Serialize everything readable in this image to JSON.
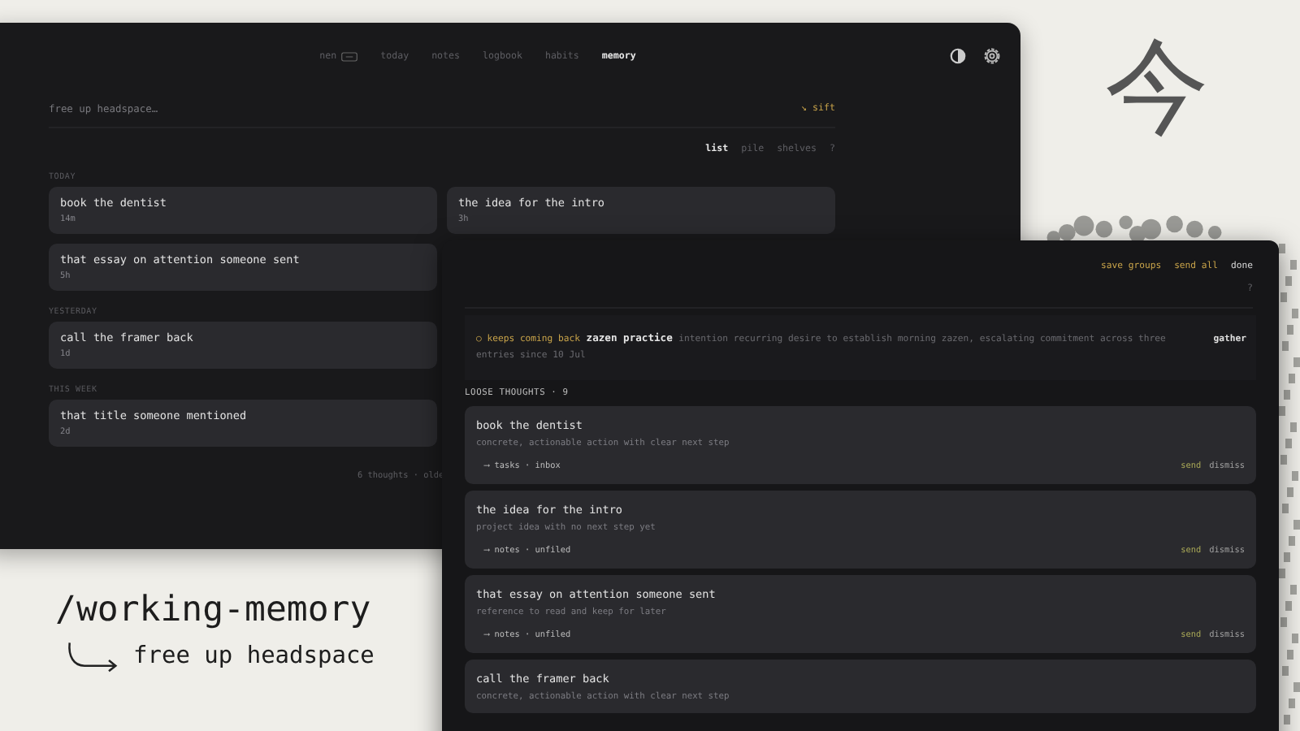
{
  "backdrop": {
    "glyph": "今",
    "title": "/working-memory",
    "tagline": "free up headspace"
  },
  "main_window": {
    "nav": [
      {
        "label": "nen",
        "kind": "brand",
        "selected": false
      },
      {
        "label": "today",
        "kind": "link",
        "selected": false
      },
      {
        "label": "notes",
        "kind": "link",
        "selected": false
      },
      {
        "label": "logbook",
        "kind": "link",
        "selected": false
      },
      {
        "label": "habits",
        "kind": "link",
        "selected": false
      },
      {
        "label": "memory",
        "kind": "link",
        "selected": true
      }
    ],
    "input": {
      "placeholder": "free up headspace…"
    },
    "sift": "↘ sift",
    "views": [
      {
        "label": "list",
        "selected": true
      },
      {
        "label": "pile",
        "selected": false
      },
      {
        "label": "shelves",
        "selected": false
      }
    ],
    "help": "?",
    "sections": [
      {
        "heading": "TODAY",
        "cards": [
          {
            "title": "book the dentist",
            "age": "14m"
          },
          {
            "title": "the idea for the intro",
            "age": "3h"
          },
          {
            "title": "that essay on attention someone sent",
            "age": "5h"
          }
        ]
      },
      {
        "heading": "YESTERDAY",
        "cards": [
          {
            "title": "call the framer back",
            "age": "1d"
          }
        ]
      },
      {
        "heading": "THIS WEEK",
        "cards": [
          {
            "title": "that title someone mentioned",
            "age": "2d"
          }
        ]
      }
    ],
    "footer": "6 thoughts · olde"
  },
  "sort_window": {
    "actions": [
      {
        "label": "save groups",
        "kind": "accent"
      },
      {
        "label": "send all",
        "kind": "accent"
      },
      {
        "label": "done",
        "kind": "plain"
      }
    ],
    "help": "?",
    "banner": {
      "tag": "○ keeps coming back",
      "title": "zazen practice",
      "text": "intention recurring desire to establish morning zazen, escalating commitment across three entries since 10 Jul",
      "action": "gather"
    },
    "heading": "LOOSE THOUGHTS · 9",
    "thoughts": [
      {
        "title": "book the dentist",
        "note": "concrete, actionable action with clear next step",
        "route": "⟶ tasks · inbox",
        "send": "send",
        "dismiss": "dismiss"
      },
      {
        "title": "the idea for the intro",
        "note": "project idea with no next step yet",
        "route": "⟶ notes · unfiled",
        "send": "send",
        "dismiss": "dismiss"
      },
      {
        "title": "that essay on attention someone sent",
        "note": "reference to read and keep for later",
        "route": "⟶ notes · unfiled",
        "send": "send",
        "dismiss": "dismiss"
      },
      {
        "title": "call the framer back",
        "note": "concrete, actionable action with clear next step"
      }
    ]
  }
}
